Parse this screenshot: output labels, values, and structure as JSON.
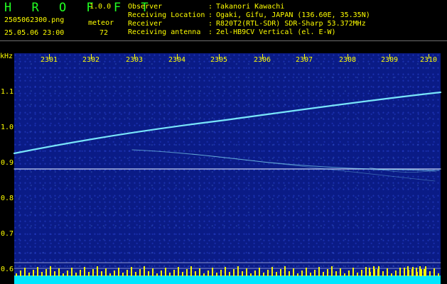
{
  "header": {
    "title": "H R O F F T",
    "version": "1.0.0",
    "filename": "2505062300.png",
    "datetime": "25.05.06 23:00",
    "meteor_label": "meteor",
    "meteor_count": "72"
  },
  "info": [
    {
      "key": "Observer",
      "value": "Takanori Kawachi"
    },
    {
      "key": "Receiving Location",
      "value": "Ogaki, Gifu, JAPAN (136.60E, 35.35N)"
    },
    {
      "key": "Receiver",
      "value": "R820T2(RTL-SDR) SDR-Sharp 53.372MHz"
    },
    {
      "key": "Receiving antenna",
      "value": "2el-HB9CV Vertical (el. E-W)"
    }
  ],
  "chart_data": {
    "type": "spectrogram",
    "x_ticks": [
      "2301",
      "2302",
      "2303",
      "2304",
      "2305",
      "2306",
      "2307",
      "2308",
      "2309",
      "2310"
    ],
    "y_unit": "kHz",
    "y_ticks": [
      "1.1",
      "1.0",
      "0.9",
      "0.8",
      "0.7",
      "0.6"
    ],
    "colors": {
      "background": "#000000",
      "plot_background": "#0a1b86",
      "trace": "#7ff0ff",
      "text": "#ffff00",
      "title": "#22ff22",
      "bottom_band": "#00e6ff",
      "bottom_spikes": "#ffff00"
    }
  }
}
